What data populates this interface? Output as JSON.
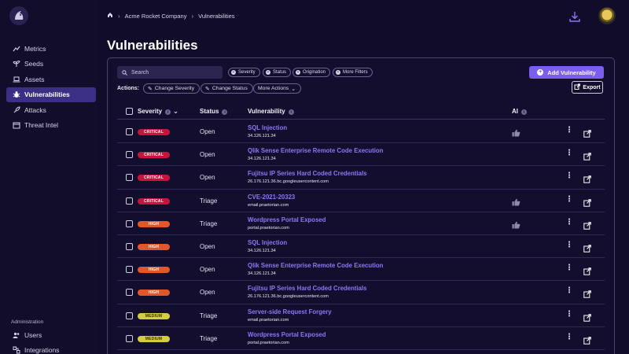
{
  "sidebar": {
    "items": [
      {
        "label": "Metrics",
        "icon": "chart-line-icon"
      },
      {
        "label": "Seeds",
        "icon": "seedling-icon"
      },
      {
        "label": "Assets",
        "icon": "laptop-icon"
      },
      {
        "label": "Vulnerabilities",
        "icon": "bug-icon",
        "active": true
      },
      {
        "label": "Attacks",
        "icon": "rocket-icon"
      },
      {
        "label": "Threat Intel",
        "icon": "calendar-icon"
      }
    ],
    "admin_heading": "Administration",
    "admin_items": [
      {
        "label": "Users",
        "icon": "users-icon"
      },
      {
        "label": "Integrations",
        "icon": "integrations-icon"
      }
    ]
  },
  "breadcrumb": {
    "org": "Acme Rocket Company",
    "page": "Vulnerabilities"
  },
  "page_title": "Vulnerabilities",
  "toolbar": {
    "search_placeholder": "Search",
    "filters": [
      "Severity",
      "Status",
      "Origination",
      "More Filters"
    ],
    "add_label": "Add Vulnerability",
    "actions_label": "Actions:",
    "change_severity": "Change Severity",
    "change_status": "Change Status",
    "more_actions": "More Actions",
    "export_label": "Export"
  },
  "table": {
    "headers": {
      "severity": "Severity",
      "status": "Status",
      "vulnerability": "Vulnerability",
      "ai": "AI"
    },
    "rows": [
      {
        "severity": "CRITICAL",
        "status": "Open",
        "title": "SQL Injection",
        "host": "34.126.121.34",
        "ai": true
      },
      {
        "severity": "CRITICAL",
        "status": "Open",
        "title": "Qlik Sense Enterprise Remote Code Execution",
        "host": "34.126.121.34",
        "ai": false
      },
      {
        "severity": "CRITICAL",
        "status": "Open",
        "title": "Fujitsu IP Series Hard Coded Credentials",
        "host": "26.176.121.36.bc.googleusercontent.com",
        "ai": false
      },
      {
        "severity": "CRITICAL",
        "status": "Triage",
        "title": "CVE-2021-20323",
        "host": "email.praetorian.com",
        "ai": true
      },
      {
        "severity": "HIGH",
        "status": "Triage",
        "title": "Wordpress Portal Exposed",
        "host": "portal.praetorian.com",
        "ai": true
      },
      {
        "severity": "HIGH",
        "status": "Open",
        "title": "SQL Injection",
        "host": "34.126.121.34",
        "ai": false
      },
      {
        "severity": "HIGH",
        "status": "Open",
        "title": "Qlik Sense Enterprise Remote Code Execution",
        "host": "34.126.121.34",
        "ai": false
      },
      {
        "severity": "HIGH",
        "status": "Open",
        "title": "Fujitsu IP Series Hard Coded Credentials",
        "host": "26.176.121.36.bc.googleusercontent.com",
        "ai": false
      },
      {
        "severity": "MEDIUM",
        "status": "Triage",
        "title": "Server-side Request Forgery",
        "host": "email.praetorian.com",
        "ai": false
      },
      {
        "severity": "MEDIUM",
        "status": "Triage",
        "title": "Wordpress Portal Exposed",
        "host": "portal.praetorian.com",
        "ai": false
      }
    ]
  },
  "colors": {
    "background": "#110c29",
    "accent": "#7b5df0",
    "critical": "#c8143c",
    "high": "#e0582a",
    "medium": "#d3cc3c"
  }
}
